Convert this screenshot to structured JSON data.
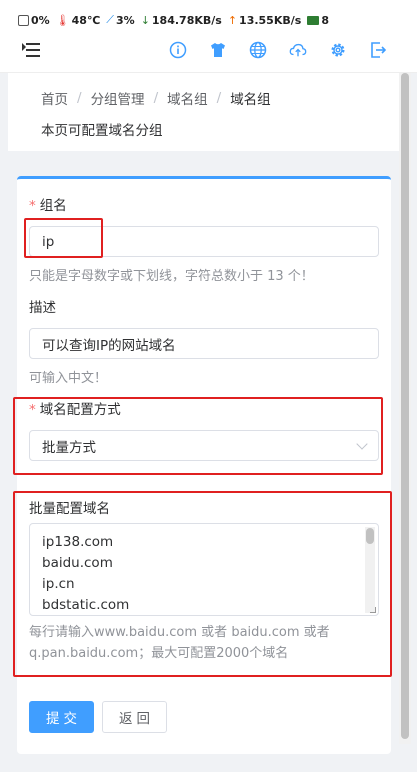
{
  "statusbar": {
    "cpu": "0%",
    "temp": "48℃",
    "disk": "3%",
    "download": "184.78KB/s",
    "upload": "13.55KB/s",
    "screens": "8"
  },
  "toolbar": {
    "icons": [
      "info-icon",
      "shirt-icon",
      "globe-icon",
      "cloud-upload-icon",
      "gear-icon",
      "logout-icon"
    ]
  },
  "breadcrumb": {
    "items": [
      "首页",
      "分组管理",
      "域名组",
      "域名组"
    ],
    "separator": "/"
  },
  "page": {
    "description": "本页可配置域名分组"
  },
  "form": {
    "group_name": {
      "label": "组名",
      "required_mark": "*",
      "value": "ip",
      "hint": "只能是字母数字或下划线，字符总数小于 13 个！"
    },
    "description": {
      "label": "描述",
      "value": "可以查询IP的网站域名",
      "hint": "可输入中文！"
    },
    "config_mode": {
      "label": "域名配置方式",
      "required_mark": "*",
      "selected": "批量方式"
    },
    "batch_domains": {
      "label": "批量配置域名",
      "lines": [
        "ip138.com",
        "baidu.com",
        "ip.cn",
        "bdstatic.com"
      ],
      "hint_line1": "每行请输入www.baidu.com 或者 baidu.com 或者",
      "hint_line2": "q.pan.baidu.com；最大可配置2000个域名"
    },
    "submit_label": "提交",
    "back_label": "返回"
  },
  "colors": {
    "primary": "#409eff",
    "highlight": "#e02020",
    "required": "#f56c6c"
  }
}
